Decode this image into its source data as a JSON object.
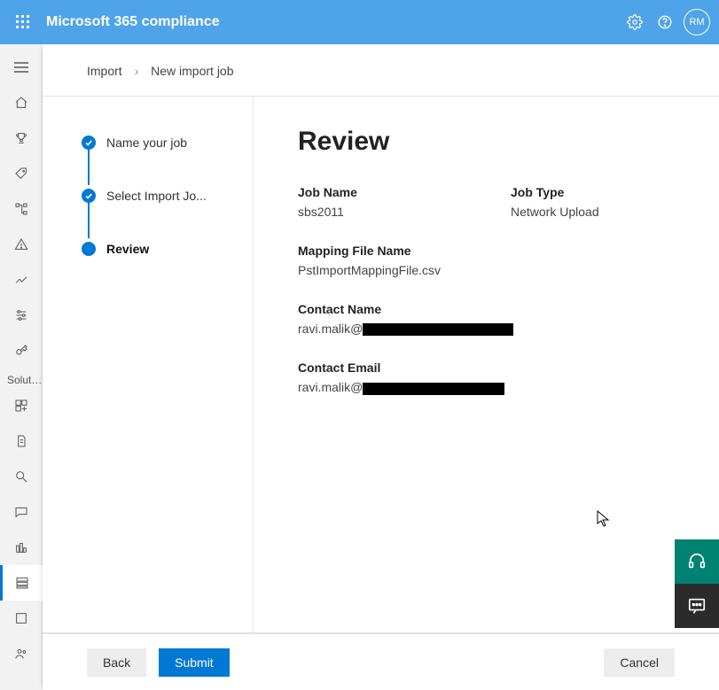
{
  "header": {
    "app_title": "Microsoft 365 compliance",
    "avatar_initials": "RM"
  },
  "leftrail": {
    "section_label": "Solut…"
  },
  "breadcrumb": {
    "parent": "Import",
    "current": "New import job"
  },
  "wizard": {
    "steps": [
      {
        "label": "Name your job"
      },
      {
        "label": "Select Import Jo..."
      },
      {
        "label": "Review"
      }
    ]
  },
  "review": {
    "title": "Review",
    "fields": {
      "job_name_label": "Job Name",
      "job_name_value": "sbs2011",
      "job_type_label": "Job Type",
      "job_type_value": "Network Upload",
      "mapping_file_label": "Mapping File Name",
      "mapping_file_value": "PstImportMappingFile.csv",
      "contact_name_label": "Contact Name",
      "contact_name_value_prefix": "ravi.malik@",
      "contact_email_label": "Contact Email",
      "contact_email_value_prefix": "ravi.malik@"
    }
  },
  "footer": {
    "back_label": "Back",
    "submit_label": "Submit",
    "cancel_label": "Cancel"
  }
}
